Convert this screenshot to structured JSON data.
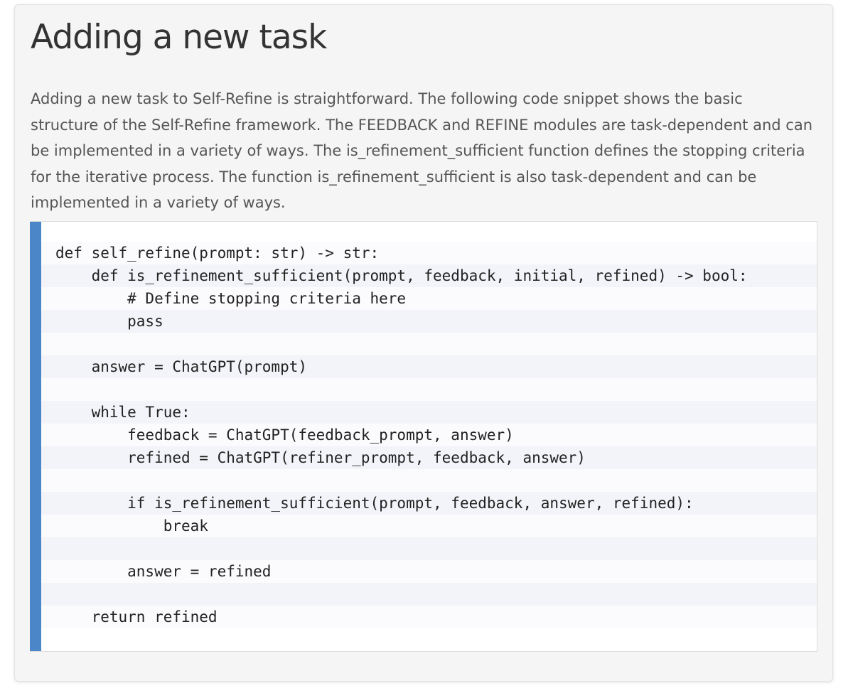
{
  "section": {
    "title": "Adding a new task",
    "description": "Adding a new task to Self-Refine is straightforward. The following code snippet shows the basic structure of the Self-Refine framework. The FEEDBACK and REFINE modules are task-dependent and can be implemented in a variety of ways. The is_refinement_sufficient function defines the stopping criteria for the iterative process. The function is_refinement_sufficient is also task-dependent and can be implemented in a variety of ways."
  },
  "code": {
    "lines": [
      "def self_refine(prompt: str) -> str:",
      "    def is_refinement_sufficient(prompt, feedback, initial, refined) -> bool:",
      "        # Define stopping criteria here",
      "        pass",
      "",
      "    answer = ChatGPT(prompt)",
      "",
      "    while True:",
      "        feedback = ChatGPT(feedback_prompt, answer)",
      "        refined = ChatGPT(refiner_prompt, feedback, answer)",
      "",
      "        if is_refinement_sufficient(prompt, feedback, answer, refined):",
      "            break",
      "",
      "        answer = refined",
      "",
      "    return refined"
    ]
  },
  "colors": {
    "accent_bar": "#4a86c8",
    "card_background": "#f5f5f5",
    "title_text": "#333333",
    "body_text": "#555555"
  }
}
